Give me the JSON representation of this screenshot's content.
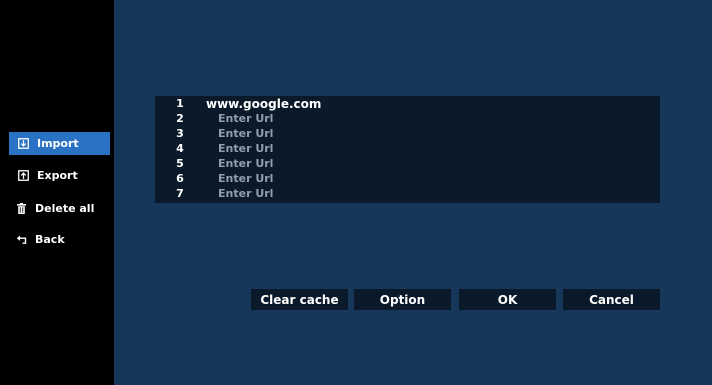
{
  "sidebar": {
    "items": [
      {
        "label": "Import",
        "icon": "import-icon",
        "active": true
      },
      {
        "label": "Export",
        "icon": "export-icon",
        "active": false
      },
      {
        "label": "Delete all",
        "icon": "trash-icon",
        "active": false
      },
      {
        "label": "Back",
        "icon": "back-icon",
        "active": false
      }
    ]
  },
  "url_list": {
    "rows": [
      {
        "number": "1",
        "value": "www.google.com",
        "placeholder": ""
      },
      {
        "number": "2",
        "value": "",
        "placeholder": "Enter Url"
      },
      {
        "number": "3",
        "value": "",
        "placeholder": "Enter Url"
      },
      {
        "number": "4",
        "value": "",
        "placeholder": "Enter Url"
      },
      {
        "number": "5",
        "value": "",
        "placeholder": "Enter Url"
      },
      {
        "number": "6",
        "value": "",
        "placeholder": "Enter Url"
      },
      {
        "number": "7",
        "value": "",
        "placeholder": "Enter Url"
      }
    ]
  },
  "buttons": {
    "clear_cache": "Clear cache",
    "option": "Option",
    "ok": "OK",
    "cancel": "Cancel"
  },
  "colors": {
    "background": "#17375a",
    "sidebar": "#000000",
    "active_item": "#2a72c4",
    "panel": "#0b1a2a",
    "placeholder_text": "#8f9eb0"
  }
}
